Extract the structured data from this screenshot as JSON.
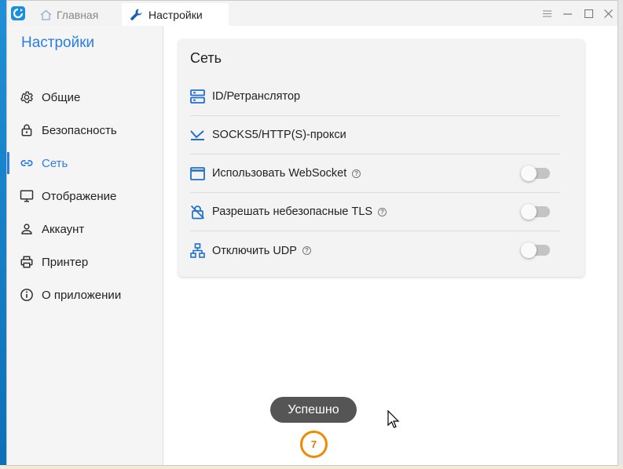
{
  "titlebar": {
    "tabs": [
      {
        "label": "Главная",
        "icon": "home-icon"
      },
      {
        "label": "Настройки",
        "icon": "wrench-icon"
      }
    ]
  },
  "sidebar": {
    "title": "Настройки",
    "items": [
      {
        "label": "Общие",
        "icon": "gear-icon",
        "active": false
      },
      {
        "label": "Безопасность",
        "icon": "lock-icon",
        "active": false
      },
      {
        "label": "Сеть",
        "icon": "link-icon",
        "active": true
      },
      {
        "label": "Отображение",
        "icon": "monitor-icon",
        "active": false
      },
      {
        "label": "Аккаунт",
        "icon": "person-icon",
        "active": false
      },
      {
        "label": "Принтер",
        "icon": "printer-icon",
        "active": false
      },
      {
        "label": "О приложении",
        "icon": "info-icon",
        "active": false
      }
    ]
  },
  "network": {
    "title": "Сеть",
    "rows": [
      {
        "label": "ID/Ретранслятор",
        "icon": "server-icon"
      },
      {
        "label": "SOCKS5/HTTP(S)-прокси",
        "icon": "proxy-icon"
      },
      {
        "label": "Использовать WebSocket",
        "icon": "window-icon",
        "help": "?",
        "toggle": false
      },
      {
        "label": "Разрешать небезопасные TLS",
        "icon": "lock-off-icon",
        "help": "?",
        "toggle": false
      },
      {
        "label": "Отключить UDP",
        "icon": "network-icon",
        "help": "?",
        "toggle": false
      }
    ]
  },
  "toast": {
    "text": "Успешно"
  },
  "step_badge": {
    "text": "7"
  },
  "colors": {
    "accent": "#2b7de1",
    "badge": "#f08a00"
  }
}
